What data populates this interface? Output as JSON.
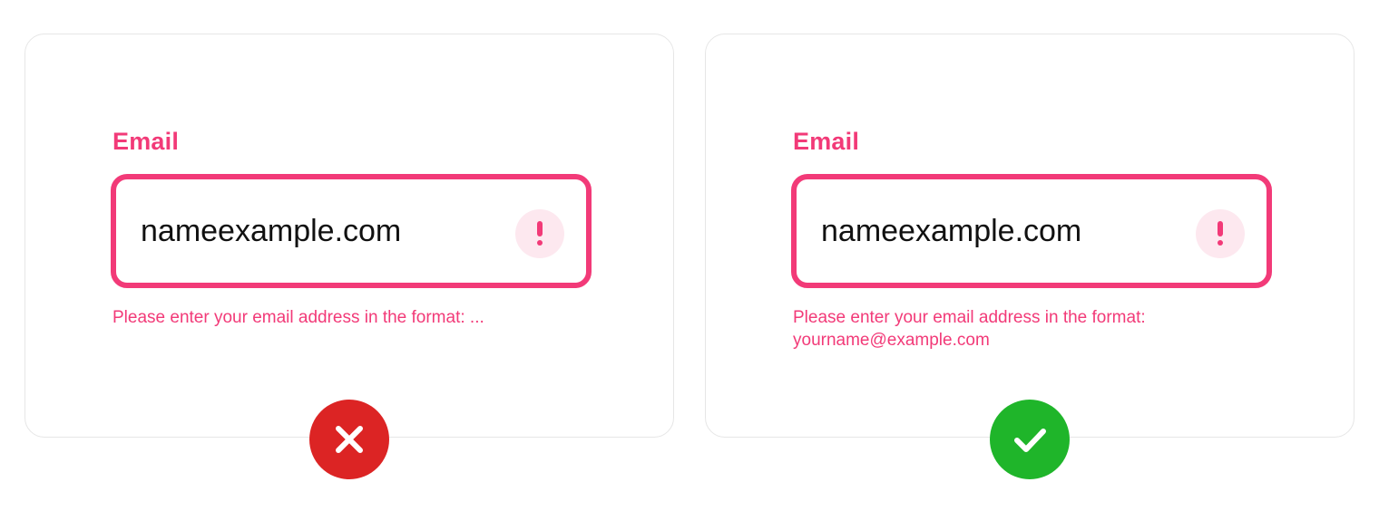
{
  "examples": [
    {
      "verdict": "incorrect",
      "field_label": "Email",
      "input_value": "nameexample.com",
      "error_message": "Please enter your email address in the format: ...",
      "status_icon": "close-icon",
      "status_color": "#dc2424"
    },
    {
      "verdict": "correct",
      "field_label": "Email",
      "input_value": "nameexample.com",
      "error_message_line1": "Please enter your email address in the format:",
      "error_message_line2": "yourname@example.com",
      "status_icon": "check-icon",
      "status_color": "#1fb52a"
    }
  ],
  "colors": {
    "error_accent": "#f23a78",
    "alert_bg": "#fde8ef",
    "card_border": "#e6e6e6"
  },
  "icons": {
    "field_alert": "exclamation-icon"
  }
}
